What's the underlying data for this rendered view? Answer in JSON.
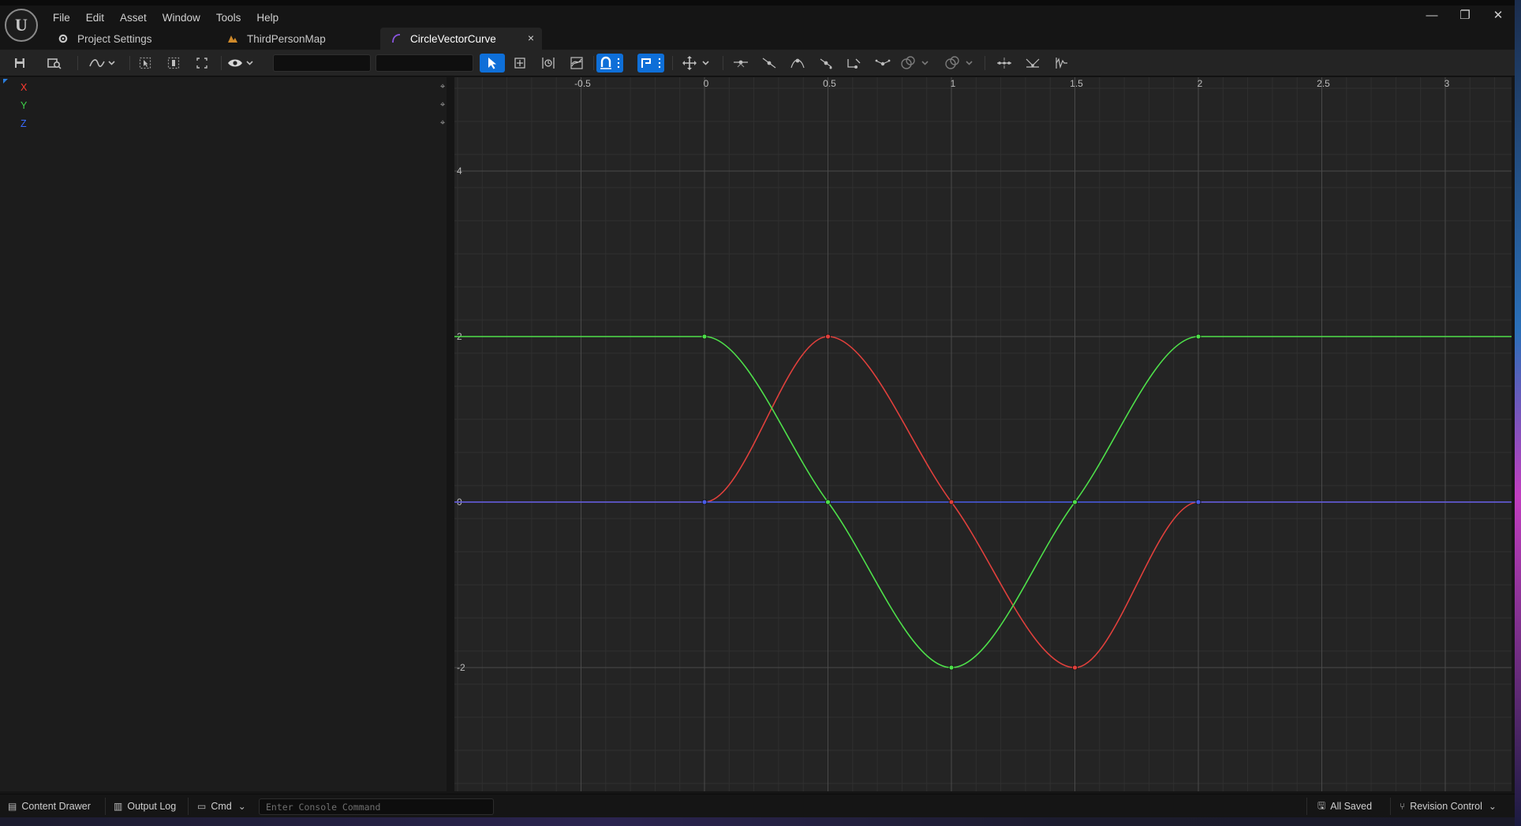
{
  "app": {
    "window_title": "CircleVectorCurve",
    "menu": [
      "File",
      "Edit",
      "Asset",
      "Window",
      "Tools",
      "Help"
    ],
    "tabs": [
      {
        "label": "Project Settings",
        "icon": "gear-icon"
      },
      {
        "label": "ThirdPersonMap",
        "icon": "map-icon"
      },
      {
        "label": "CircleVectorCurve",
        "icon": "curve-asset-icon",
        "active": true
      }
    ],
    "tab_close_glyph": "×",
    "window_controls": [
      "—",
      "❐",
      "✕"
    ]
  },
  "toolbar": {
    "icons": [
      "save-icon",
      "browse-icon",
      "curve-type-icon",
      "select-keys-icon",
      "frame-icon",
      "fit-icon",
      "visibility-icon",
      "pointer-icon",
      "transform-icon",
      "retime-icon",
      "multi-scale-icon",
      "snap-magnet-icon",
      "snap-value-icon",
      "move-gizmo-icon",
      "flatten-tangents-icon",
      "straighten-tangents-icon",
      "auto-tangent-icon",
      "user-tangent-icon",
      "break-tangent-icon",
      "weighted-tangent-icon",
      "pre-infinity-icon",
      "post-infinity-icon",
      "key-reduce-icon",
      "smooth-icon",
      "filter-icon"
    ],
    "time_field_value": "",
    "value_field_value": "",
    "accent": "#0e6fd8"
  },
  "tree": {
    "items": [
      {
        "label": "X",
        "color": "#ff3b30"
      },
      {
        "label": "Y",
        "color": "#3fd24a"
      },
      {
        "label": "Z",
        "color": "#3a6cff"
      }
    ],
    "pin_glyph": "⌖"
  },
  "chart_data": {
    "type": "line",
    "title": "",
    "xlabel": "",
    "ylabel": "",
    "xlim": [
      -1.0,
      3.25
    ],
    "ylim": [
      -3.3,
      5.0
    ],
    "x_ticks": [
      -0.5,
      0,
      0.5,
      1,
      1.5,
      2,
      2.5,
      3
    ],
    "x_tick_labels": [
      "-0.5",
      "0",
      "0.5",
      "1",
      "1.5",
      "2",
      "2.5",
      "3"
    ],
    "y_ticks": [
      4,
      2,
      0,
      -2
    ],
    "y_tick_labels": [
      "4",
      "2",
      "0",
      "-2"
    ],
    "grid": true,
    "series": [
      {
        "name": "X",
        "color": "#e0403c",
        "keys": [
          [
            0,
            0
          ],
          [
            0.5,
            2
          ],
          [
            1,
            0
          ],
          [
            1.5,
            -2
          ],
          [
            2,
            0
          ]
        ]
      },
      {
        "name": "Y",
        "color": "#4ee04a",
        "keys": [
          [
            0,
            2
          ],
          [
            0.5,
            0
          ],
          [
            1,
            -2
          ],
          [
            1.5,
            0
          ],
          [
            2,
            2
          ]
        ]
      },
      {
        "name": "Z",
        "color": "#4a5ce8",
        "keys": [
          [
            0,
            0
          ],
          [
            2,
            0
          ]
        ]
      }
    ]
  },
  "statusbar": {
    "content_drawer": "Content Drawer",
    "output_log": "Output Log",
    "cmd": "Cmd",
    "console_placeholder": "Enter Console Command",
    "all_saved": "All Saved",
    "revision_control": "Revision Control"
  }
}
